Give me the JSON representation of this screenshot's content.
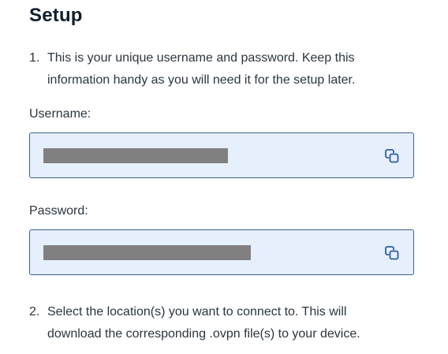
{
  "setup": {
    "title": "Setup",
    "steps": [
      {
        "number": "1.",
        "text": "This is your unique username and password. Keep this information handy as you will need it for the setup later."
      },
      {
        "number": "2.",
        "text": "Select the location(s) you want to connect to. This will download the corresponding .ovpn file(s) to your device."
      }
    ],
    "username": {
      "label": "Username:",
      "value_state": "redacted",
      "copy_icon": "copy-icon"
    },
    "password": {
      "label": "Password:",
      "value_state": "redacted",
      "copy_icon": "copy-icon"
    }
  },
  "colors": {
    "field_background": "#e6f0fc",
    "field_border": "#3b5f93",
    "redaction": "#808080",
    "icon": "#2d5e9e",
    "heading": "#0f1f2e",
    "body_text": "#2b3640"
  }
}
